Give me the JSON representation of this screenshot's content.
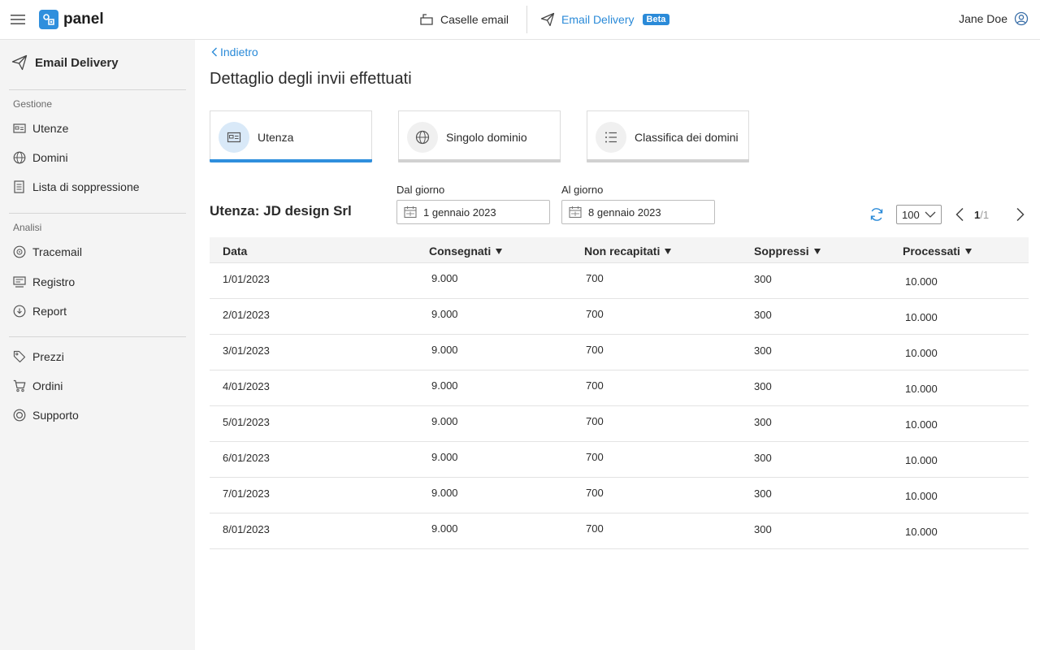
{
  "app": {
    "logo_text": "panel",
    "accent_color": "#2a8ad8"
  },
  "topnav": {
    "items": [
      {
        "label": "Caselle email",
        "icon": "mailbox-icon"
      },
      {
        "label": "Email Delivery",
        "icon": "paper-plane-icon",
        "badge": "Beta",
        "active": true
      }
    ]
  },
  "user": {
    "name": "Jane Doe",
    "icon": "user-circle-icon"
  },
  "sidebar": {
    "title": "Email Delivery",
    "groups": [
      {
        "label": "Gestione",
        "items": [
          {
            "label": "Utenze",
            "icon": "account-card-icon"
          },
          {
            "label": "Domini",
            "icon": "globe-icon"
          },
          {
            "label": "Lista di soppressione",
            "icon": "list-document-icon"
          }
        ]
      },
      {
        "label": "Analisi",
        "items": [
          {
            "label": "Tracemail",
            "icon": "target-icon"
          },
          {
            "label": "Registro",
            "icon": "log-icon"
          },
          {
            "label": "Report",
            "icon": "cloud-download-icon"
          }
        ]
      },
      {
        "label": "",
        "items": [
          {
            "label": "Prezzi",
            "icon": "tag-icon"
          },
          {
            "label": "Ordini",
            "icon": "cart-icon"
          },
          {
            "label": "Supporto",
            "icon": "lifebuoy-icon"
          }
        ]
      }
    ]
  },
  "main": {
    "back_label": "Indietro",
    "page_title": "Dettaglio degli invii effettuati",
    "tabs": [
      {
        "label": "Utenza",
        "icon": "account-card-icon",
        "active": true
      },
      {
        "label": "Singolo dominio",
        "icon": "globe-icon",
        "active": false
      },
      {
        "label": "Classifica dei domini",
        "icon": "ranking-list-icon",
        "active": false
      }
    ],
    "section_title": "Utenza: JD design Srl",
    "date_from": {
      "label": "Dal giorno",
      "value": "1 gennaio 2023"
    },
    "date_to": {
      "label": "Al giorno",
      "value": "8 gennaio 2023"
    },
    "page_size": "100",
    "pager": {
      "current": "1",
      "total": "/1"
    }
  },
  "table": {
    "columns": [
      "Data",
      "Consegnati",
      "Non recapitati",
      "Soppressi",
      "Processati"
    ],
    "rows": [
      [
        "1/01/2023",
        "9.000",
        "700",
        "300",
        "10.000"
      ],
      [
        "2/01/2023",
        "9.000",
        "700",
        "300",
        "10.000"
      ],
      [
        "3/01/2023",
        "9.000",
        "700",
        "300",
        "10.000"
      ],
      [
        "4/01/2023",
        "9.000",
        "700",
        "300",
        "10.000"
      ],
      [
        "5/01/2023",
        "9.000",
        "700",
        "300",
        "10.000"
      ],
      [
        "6/01/2023",
        "9.000",
        "700",
        "300",
        "10.000"
      ],
      [
        "7/01/2023",
        "9.000",
        "700",
        "300",
        "10.000"
      ],
      [
        "8/01/2023",
        "9.000",
        "700",
        "300",
        "10.000"
      ]
    ]
  }
}
